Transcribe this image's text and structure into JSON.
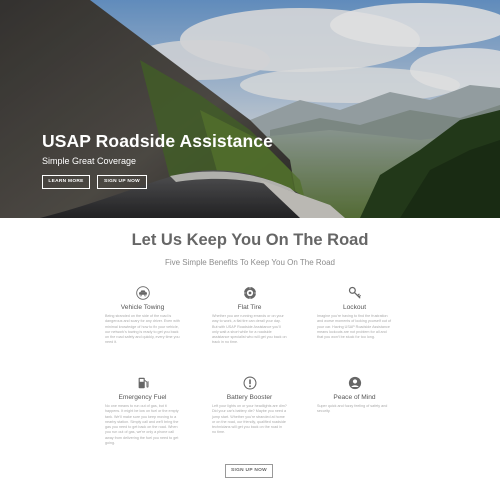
{
  "hero": {
    "title": "USAP Roadside Assistance",
    "subtitle": "Simple Great Coverage",
    "learn_more_label": "LEARN MORE",
    "sign_up_label": "SIGN UP NOW"
  },
  "section": {
    "headline": "Let Us Keep You On The Road",
    "subheadline": "Five Simple Benefits To Keep You On The Road"
  },
  "benefits": [
    {
      "icon": "car-towing-icon",
      "title": "Vehicle Towing",
      "description": "Being stranded on the side of the road is dangerous and scary for any driver. Even with minimal knowledge of how to fix your vehicle, our network's towing is ready to get you back on the road safely and quickly, every time you need it."
    },
    {
      "icon": "tire-icon",
      "title": "Flat Tire",
      "description": "Whether you are running errands or on your way to work, a flat tire can derail your day. But with USAP Roadside Assistance you'll only wait a short while for a roadside assistance specialist who will get you back on track in no time."
    },
    {
      "icon": "key-icon",
      "title": "Lockout",
      "description": "Imagine you're having to find the frustration and worse moments of locking yourself out of your car. Having USAP Roadside Assistance means lockouts are not problem for all and that you won't be stuck for too long."
    },
    {
      "icon": "fuel-pump-icon",
      "title": "Emergency Fuel",
      "description": "No one means to run out of gas, but it happens. It might be low on fuel or the empty tank. We'll make sure you keep moving to a nearby station. Simply call and we'll bring the gas you need to get back on the road. When you run out of gas, we're only a phone call away from delivering the fuel you need to get going."
    },
    {
      "icon": "battery-warning-icon",
      "title": "Battery Booster",
      "description": "Left your lights on or your headlights are dim? Did your car's battery die? Maybe you need a jump start. Whether you're stranded at home or on the road, our friendly, qualified roadside technicians will get you back on the road in no time."
    },
    {
      "icon": "person-icon",
      "title": "Peace of Mind",
      "description": "Super quick and fuzzy feeling of safety and security."
    }
  ],
  "bottom": {
    "sign_up_label": "SIGN UP NOW"
  },
  "colors": {
    "sky": "#8fb8e3",
    "mountain_rock": "#4a4845",
    "forest": "#2e4a22",
    "heading_gray": "#666666",
    "subheading_gray": "#8c8c8c"
  }
}
